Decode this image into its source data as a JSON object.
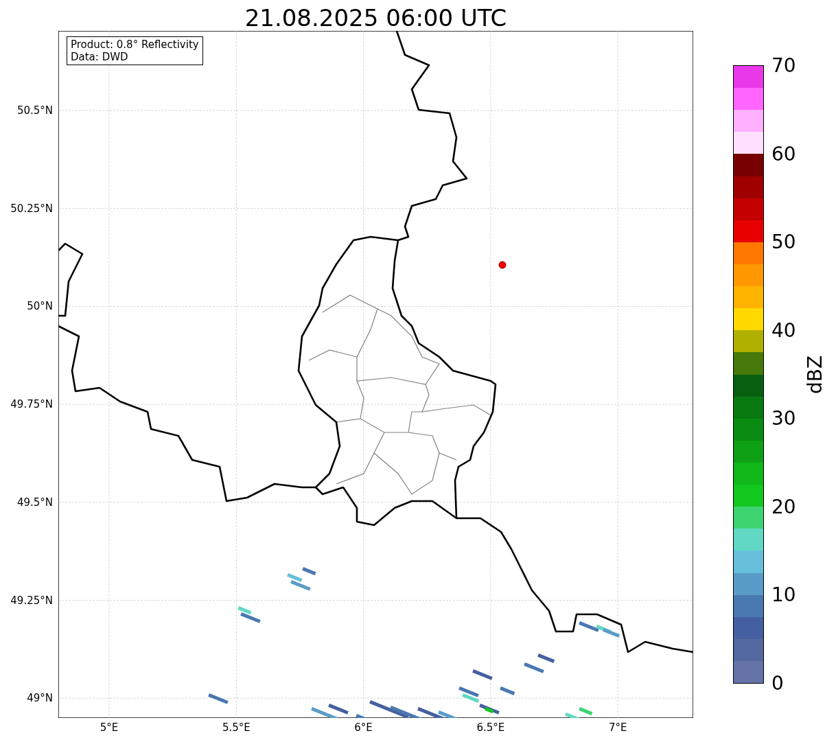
{
  "title": "21.08.2025 06:00 UTC",
  "info_box": {
    "lines": [
      "Product: 0.8° Reflectivity",
      "Data: DWD"
    ]
  },
  "y_ticks": [
    "50.5°N",
    "50.25°N",
    "50°N",
    "49.75°N",
    "49.5°N",
    "49.25°N",
    "49°N"
  ],
  "x_ticks": [
    "5°E",
    "5.5°E",
    "6°E",
    "6.5°E",
    "7°E"
  ],
  "colorbar": {
    "label": "dBZ",
    "ticks": [
      "70",
      "60",
      "50",
      "40",
      "30",
      "20",
      "10",
      "0"
    ],
    "bins": [
      {
        "color": "#e838e8"
      },
      {
        "color": "#ff66ff"
      },
      {
        "color": "#ffb0ff"
      },
      {
        "color": "#ffe0ff"
      },
      {
        "color": "#780000"
      },
      {
        "color": "#a00000"
      },
      {
        "color": "#c40000"
      },
      {
        "color": "#e80000"
      },
      {
        "color": "#ff7800"
      },
      {
        "color": "#ff9800"
      },
      {
        "color": "#ffb400"
      },
      {
        "color": "#ffd800"
      },
      {
        "color": "#b0b000"
      },
      {
        "color": "#457a0a"
      },
      {
        "color": "#066010"
      },
      {
        "color": "#087a10"
      },
      {
        "color": "#0a8c12"
      },
      {
        "color": "#0ea014"
      },
      {
        "color": "#10b81a"
      },
      {
        "color": "#12c81e"
      },
      {
        "color": "#3ed470"
      },
      {
        "color": "#60d8c4"
      },
      {
        "color": "#66c0dc"
      },
      {
        "color": "#5a9cc8"
      },
      {
        "color": "#4a78b0"
      },
      {
        "color": "#4560a0"
      },
      {
        "color": "#5367a0"
      },
      {
        "color": "#6673a8"
      }
    ]
  }
}
